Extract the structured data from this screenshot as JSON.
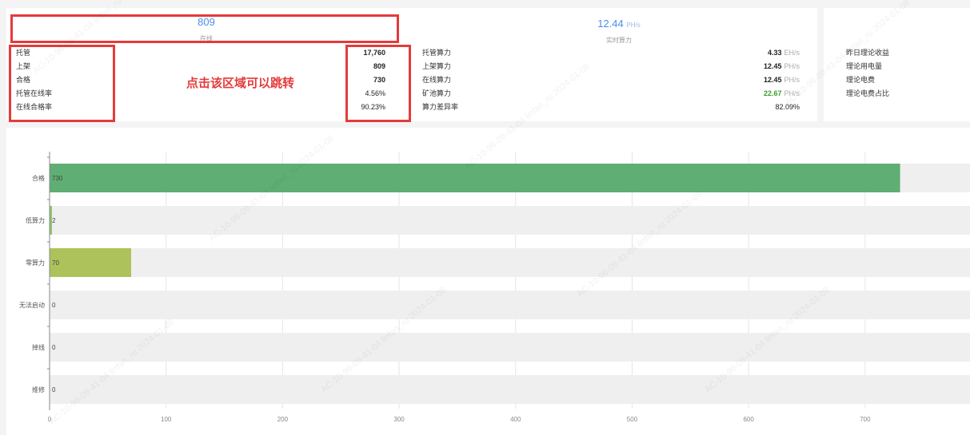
{
  "header": {
    "online": {
      "value": "809",
      "caption": "在线"
    },
    "hashrate": {
      "value": "12.44",
      "unit": "PH/s",
      "caption": "实时算力"
    }
  },
  "stats_left": [
    {
      "label": "托管",
      "value": "17,760"
    },
    {
      "label": "上架",
      "value": "809"
    },
    {
      "label": "合格",
      "value": "730"
    },
    {
      "label": "托管在线率",
      "value": "4.56%"
    },
    {
      "label": "在线合格率",
      "value": "90.23%"
    }
  ],
  "stats_mid": [
    {
      "label": "托管算力",
      "value": "4.33",
      "unit": "EH/s"
    },
    {
      "label": "上架算力",
      "value": "12.45",
      "unit": "PH/s"
    },
    {
      "label": "在线算力",
      "value": "12.45",
      "unit": "PH/s"
    },
    {
      "label": "矿池算力",
      "value": "22.67",
      "unit": "PH/s"
    },
    {
      "label": "算力差异率",
      "value": "82.09%",
      "unit": ""
    }
  ],
  "stats_right": [
    {
      "label": "昨日理论收益"
    },
    {
      "label": "理论用电量"
    },
    {
      "label": "理论电费"
    },
    {
      "label": "理论电费占比"
    }
  ],
  "annotation": {
    "text": "点击该区域可以跳转"
  },
  "watermark": {
    "text": "AC-10-96-09-41-04 linfan_ru 2024-01-08"
  },
  "colors": {
    "accent": "#4a8fe7",
    "bar_ok": "#5fae74",
    "bar_low": "#8fc16b",
    "bar_zero": "#adc25a",
    "track": "#efefef",
    "annotation": "#e43b3b",
    "green_value": "#3b9b2e"
  },
  "chart_data": {
    "type": "bar",
    "orientation": "horizontal",
    "categories": [
      "合格",
      "低算力",
      "零算力",
      "无法启动",
      "掉线",
      "维修"
    ],
    "values": [
      730,
      2,
      70,
      0,
      0,
      0
    ],
    "data_labels": [
      "730",
      "2",
      "70",
      "0",
      "0",
      "0"
    ],
    "x_ticks": [
      "0",
      "100",
      "200",
      "300",
      "400",
      "500",
      "600",
      "700"
    ],
    "xlim": [
      0,
      790
    ],
    "grid": true,
    "title": "",
    "xlabel": "",
    "ylabel": ""
  }
}
